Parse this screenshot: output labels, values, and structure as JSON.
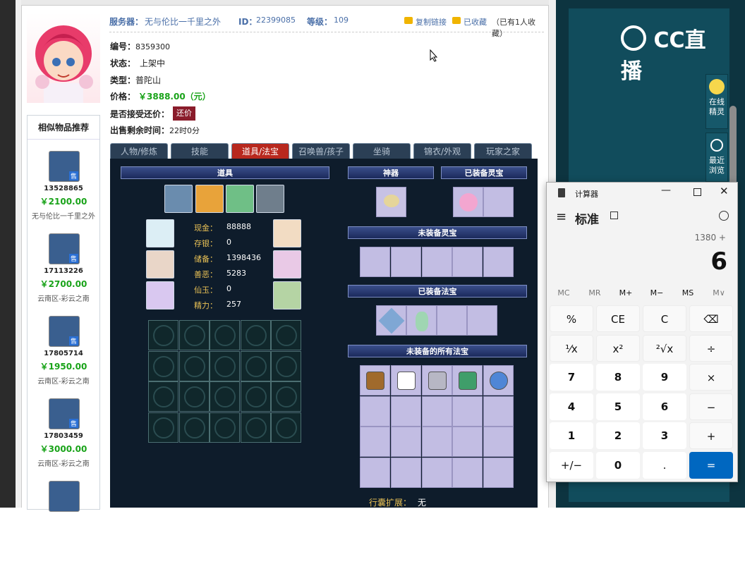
{
  "header": {
    "server_label": "服务器：",
    "server_value": "无与伦比一千里之外",
    "id_label": "ID：",
    "id_value": "22399085",
    "level_label": "等级：",
    "level_value": "109",
    "copy_link": "复制链接",
    "favorited": "已收藏",
    "fav_count": "（已有1人收藏）"
  },
  "info": {
    "number_label": "编号：",
    "number_value": "8359300",
    "status_label": "状态：",
    "status_value": "上架中",
    "type_label": "类型：",
    "type_value": "普陀山",
    "price_label": "价格：",
    "price_value": "￥3888.00（元）",
    "bargain_label": "是否接受还价：",
    "bargain_button": "还价",
    "time_label": "出售剩余时间：",
    "time_value": "22时0分"
  },
  "similar": {
    "title": "相似物品推荐",
    "items": [
      {
        "id": "13528865",
        "price": "￥2100.00",
        "server": "无与伦比一千里之外"
      },
      {
        "id": "17113226",
        "price": "￥2700.00",
        "server": "云南区-彩云之南"
      },
      {
        "id": "17805714",
        "price": "￥1950.00",
        "server": "云南区-彩云之南"
      },
      {
        "id": "17803459",
        "price": "￥3000.00",
        "server": "云南区-彩云之南"
      }
    ],
    "badge": "售"
  },
  "tabs": [
    "人物/修炼",
    "技能",
    "道具/法宝",
    "召唤兽/孩子",
    "坐骑",
    "锦衣/外观",
    "玩家之家"
  ],
  "panel": {
    "props_title": "道具",
    "artifact_title": "神器",
    "equipped_spirit_title": "已装备灵宝",
    "unequipped_spirit_title": "未装备灵宝",
    "equipped_magic_title": "已装备法宝",
    "unequipped_all_title": "未装备的所有法宝",
    "stats": [
      {
        "label": "现金：",
        "value": "88888"
      },
      {
        "label": "存银：",
        "value": "0"
      },
      {
        "label": "储备：",
        "value": "1398436"
      },
      {
        "label": "善恶：",
        "value": "5283"
      },
      {
        "label": "仙玉：",
        "value": "0"
      },
      {
        "label": "精力：",
        "value": "257"
      }
    ],
    "bag_expand_label": "行囊扩展：",
    "bag_expand_value": "无"
  },
  "cc": {
    "logo": "CC直播",
    "online_sprite": "在线精灵",
    "recent_browse": "最近浏览"
  },
  "calculator": {
    "app_title": "计算器",
    "mode": "标准",
    "expression": "1380 +",
    "display": "6",
    "memory": [
      "MC",
      "MR",
      "M+",
      "M−",
      "MS",
      "M∨"
    ],
    "row1": [
      "%",
      "CE",
      "C",
      "⌫"
    ],
    "row2": [
      "¹⁄x",
      "x²",
      "²√x",
      "÷"
    ],
    "row3": [
      "7",
      "8",
      "9",
      "×"
    ],
    "row4": [
      "4",
      "5",
      "6",
      "−"
    ],
    "row5": [
      "1",
      "2",
      "3",
      "+"
    ],
    "row6": [
      "+/−",
      "0",
      ".",
      "="
    ]
  },
  "colors": {
    "accent_blue": "#4a6fa8",
    "price_green": "#19a319",
    "tab_active": "#b8281e",
    "calc_equals": "#0067c0",
    "cc_teal": "#114c5c"
  }
}
